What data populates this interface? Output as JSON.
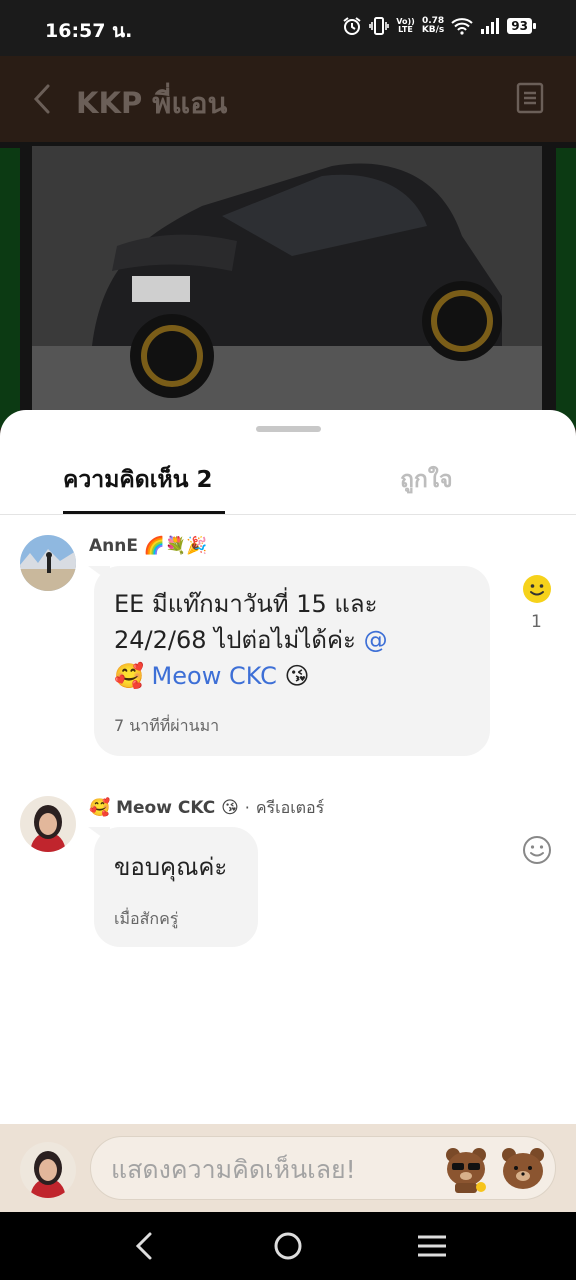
{
  "status_bar": {
    "time": "16:57 น.",
    "volte_top": "Vo))",
    "volte_bottom": "LTE",
    "net_speed_value": "0.78",
    "net_speed_unit": "KB/s",
    "battery": "93"
  },
  "app_header": {
    "title": "KKP พี่แอน"
  },
  "sheet": {
    "tabs": [
      {
        "label": "ความคิดเห็น 2",
        "active": true
      },
      {
        "label": "ถูกใจ",
        "active": false
      }
    ]
  },
  "comments": [
    {
      "author": "AnnE",
      "author_emojis": "🌈💐🎉",
      "text_line1": "EE มีแท๊กมาวันที่ 15 และ",
      "text_line2": "24/2/68 ไปต่อไม่ได้ค่ะ",
      "mention_at": "@",
      "mention_emoji": "🥰",
      "mention_name": "Meow CKC",
      "trailing_emoji": "😘",
      "time": "7 นาทีที่ผ่านมา",
      "reaction_count": "1"
    },
    {
      "author_prefix_emoji": "🥰",
      "author": "Meow CKC",
      "author_suffix_emoji": "😘",
      "separator": "·",
      "creator_label": "ครีเอเตอร์",
      "text": "ขอบคุณค่ะ",
      "time": "เมื่อสักครู่"
    }
  ],
  "input": {
    "placeholder": "แสดงความคิดเห็นเลย!"
  },
  "colors": {
    "mention": "#3d6fd6",
    "reaction_active": "#f6d21b",
    "input_bar_bg": "#ece1d5"
  },
  "icons": {
    "back": "chevron-left-icon",
    "document": "document-icon",
    "reaction": "smiley-icon",
    "nav_back": "triangle-back-icon",
    "nav_home": "circle-home-icon",
    "nav_recents": "lines-menu-icon"
  }
}
